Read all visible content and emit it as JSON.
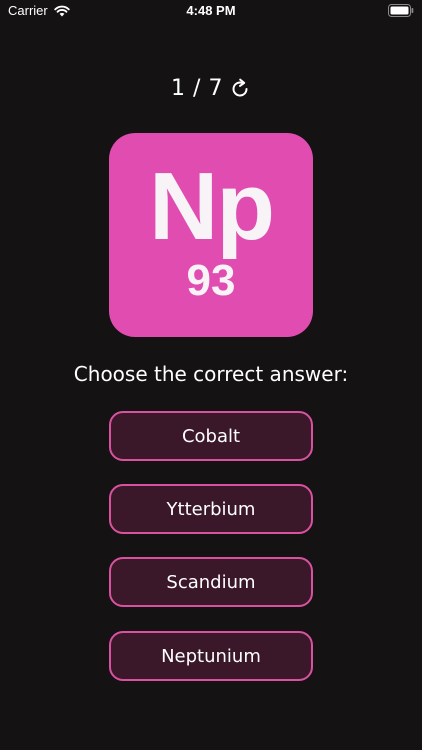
{
  "status_bar": {
    "carrier": "Carrier",
    "time": "4:48 PM",
    "wifi_icon": "wifi-icon",
    "battery_icon": "battery-icon"
  },
  "quiz": {
    "progress": "1 / 7",
    "restart_icon": "restart-icon",
    "element": {
      "symbol": "Np",
      "atomic_number": "93",
      "tile_color": "#e04cb0"
    },
    "prompt": "Choose the correct answer:",
    "answers": [
      {
        "label": "Cobalt"
      },
      {
        "label": "Ytterbium"
      },
      {
        "label": "Scandium"
      },
      {
        "label": "Neptunium"
      }
    ]
  },
  "colors": {
    "background": "#141213",
    "answer_fill": "#3a1729",
    "answer_border": "#d9529f",
    "text": "#ffffff"
  }
}
